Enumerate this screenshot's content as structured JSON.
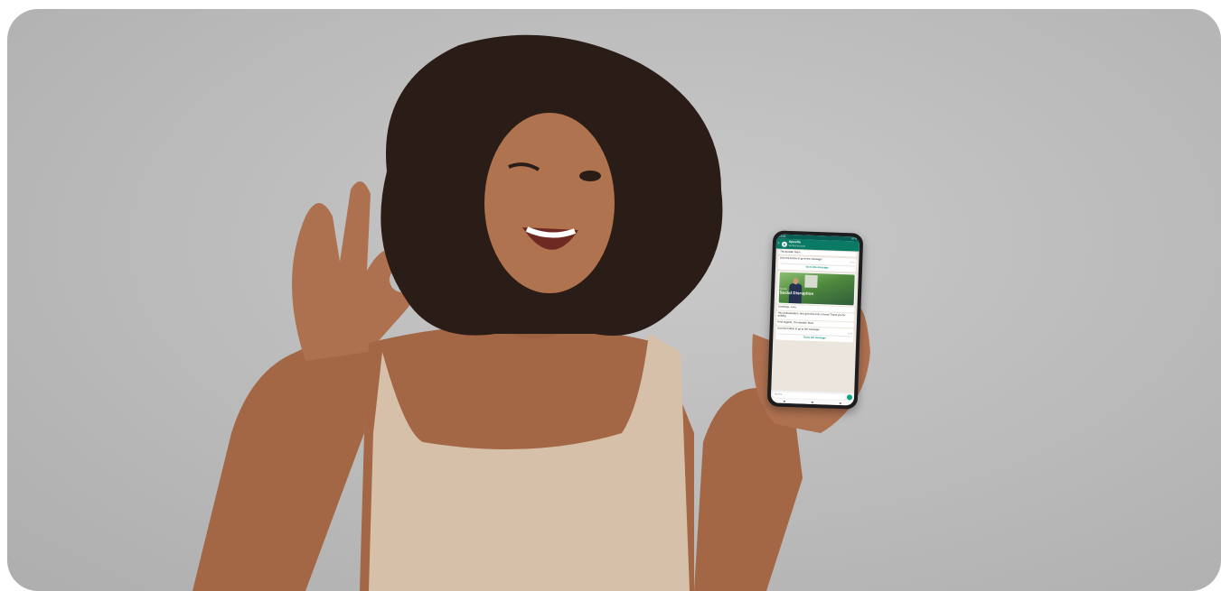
{
  "colors": {
    "background": "#bdbdbd",
    "skin": "#a86a48",
    "hair": "#2a1c16",
    "top": "#d8c2ad",
    "whatsapp_green": "#0b7a64"
  },
  "phone": {
    "status": {
      "time": "10:31",
      "battery": "97%"
    },
    "header": {
      "title": "Apostle",
      "subtitle": "Verified account"
    },
    "messages": [
      {
        "text": "The Apostle Team",
        "time": ""
      },
      {
        "text": "Give the button to go to the message!",
        "time": "10:02",
        "cta": "Go to the message"
      },
      {
        "media_label": "Social Disruption",
        "media_sub": "Apostle"
      },
      {
        "text": "Greetings, Juna,",
        "time": ""
      },
      {
        "text": "Hey Ambassadors, let's give this post a boost! Thank you for posting.",
        "time": ""
      },
      {
        "text": "Kind regards, The Apostle Team",
        "time": ""
      },
      {
        "text": "Give the button to go to the message!",
        "time": "10:31",
        "cta": "Go to the message"
      }
    ],
    "input_placeholder": "Bericht"
  }
}
